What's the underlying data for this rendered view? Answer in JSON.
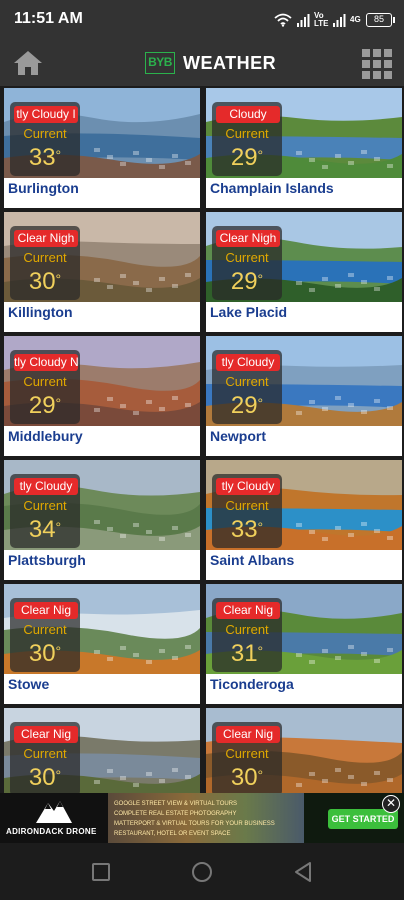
{
  "status_bar": {
    "time": "11:51 AM",
    "carrier_tag": "Vo LTE",
    "network_tag": "4G",
    "battery_percent": "85"
  },
  "app_bar": {
    "logo_text": "BYB",
    "title": "WEATHER",
    "home_icon": "home-icon",
    "grid_icon": "grid-menu-icon"
  },
  "current_label": "Current",
  "degree_symbol": "°",
  "locations": [
    {
      "name": "Burlington",
      "condition": "tly Cloudy I",
      "temp": "33"
    },
    {
      "name": "Champlain Islands",
      "condition": "Cloudy",
      "temp": "29"
    },
    {
      "name": "Killington",
      "condition": "Clear Nigh",
      "temp": "30"
    },
    {
      "name": "Lake Placid",
      "condition": "Clear Nigh",
      "temp": "29"
    },
    {
      "name": "Middlebury",
      "condition": "tly Cloudy N",
      "temp": "29"
    },
    {
      "name": "Newport",
      "condition": "tly Cloudy",
      "temp": "29"
    },
    {
      "name": "Plattsburgh",
      "condition": "tly Cloudy",
      "temp": "34"
    },
    {
      "name": "Saint Albans",
      "condition": "tly Cloudy",
      "temp": "33"
    },
    {
      "name": "Stowe",
      "condition": "Clear Nig",
      "temp": "30"
    },
    {
      "name": "Ticonderoga",
      "condition": "Clear Nig",
      "temp": "31"
    },
    {
      "name": "",
      "condition": "Clear Nig",
      "temp": "30"
    },
    {
      "name": "",
      "condition": "Clear Nig",
      "temp": "30"
    }
  ],
  "ad": {
    "brand": "ADIRONDACK DRONE",
    "lines": [
      "GOOGLE STREET VIEW & VIRTUAL TOURS",
      "COMPLETE REAL ESTATE PHOTOGRAPHY",
      "MATTERPORT & VIRTUAL TOURS FOR YOUR BUSINESS",
      "RESTAURANT, HOTEL OR EVENT SPACE"
    ],
    "cta": "GET STARTED",
    "close": "✕"
  },
  "colors": {
    "condition_badge": "#e52a2a",
    "temperature": "#f0d05c",
    "location_name": "#1a3d8f",
    "app_bar": "#333333",
    "logo": "#2bb24c"
  }
}
